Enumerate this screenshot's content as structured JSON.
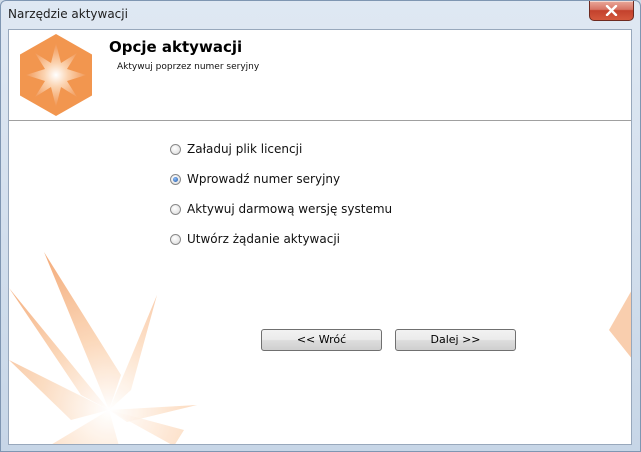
{
  "window": {
    "title": "Narzędzie aktywacji"
  },
  "header": {
    "title": "Opcje aktywacji",
    "subtitle": "Aktywuj poprzez numer seryjny"
  },
  "options": [
    {
      "label": "Załaduj plik licencji",
      "checked": false
    },
    {
      "label": "Wprowadź numer seryjny",
      "checked": true
    },
    {
      "label": "Aktywuj darmową wersję systemu",
      "checked": false
    },
    {
      "label": "Utwórz żądanie aktywacji",
      "checked": false
    }
  ],
  "buttons": {
    "back": "<< Wróć",
    "next": "Dalej >>"
  },
  "colors": {
    "accent": "#f09a5a",
    "close": "#c9452f"
  },
  "icons": {
    "logo": "hexagon-star-icon",
    "close": "close-icon"
  }
}
